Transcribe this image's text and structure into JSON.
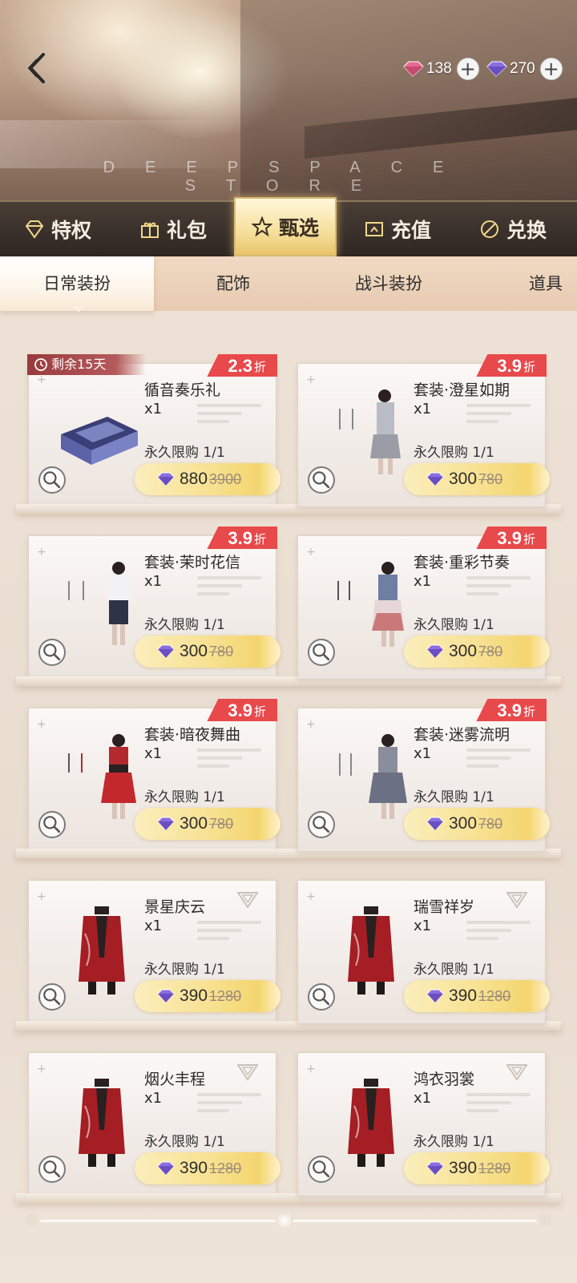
{
  "header": {
    "store_title": "DEEPSPACE STORE",
    "back_icon": "back-chevron-icon",
    "currencies": [
      {
        "icon": "pink-gem-icon",
        "amount": "138",
        "color": "#e66a8f"
      },
      {
        "icon": "purple-gem-icon",
        "amount": "270",
        "color": "#8b6ee0"
      }
    ]
  },
  "main_tabs": [
    {
      "label": "特权",
      "icon": "diamond-icon",
      "active": false
    },
    {
      "label": "礼包",
      "icon": "gift-icon",
      "active": false
    },
    {
      "label": "甄选",
      "icon": "star-icon",
      "active": true
    },
    {
      "label": "充值",
      "icon": "recharge-icon",
      "active": false
    },
    {
      "label": "兑换",
      "icon": "exchange-icon",
      "active": false
    }
  ],
  "sub_tabs": [
    {
      "label": "日常装扮",
      "active": true
    },
    {
      "label": "配饰",
      "active": false
    },
    {
      "label": "战斗装扮",
      "active": false
    },
    {
      "label": "道具",
      "active": false
    }
  ],
  "items": [
    {
      "name": "循音奏乐礼",
      "qty": "x1",
      "limit": "永久限购 1/1",
      "price": "880",
      "original_price": "3900",
      "discount": "2.3",
      "discount_unit": "折",
      "remain": "剩余15天",
      "thumb": "gift-box"
    },
    {
      "name": "套装·澄星如期",
      "qty": "x1",
      "limit": "永久限购 1/1",
      "price": "300",
      "original_price": "780",
      "discount": "3.9",
      "discount_unit": "折",
      "remain": "",
      "thumb": "outfit-grey"
    },
    {
      "name": "套装·茉时花信",
      "qty": "x1",
      "limit": "永久限购 1/1",
      "price": "300",
      "original_price": "780",
      "discount": "3.9",
      "discount_unit": "折",
      "remain": "",
      "thumb": "outfit-white"
    },
    {
      "name": "套装·重彩节奏",
      "qty": "x1",
      "limit": "永久限购 1/1",
      "price": "300",
      "original_price": "780",
      "discount": "3.9",
      "discount_unit": "折",
      "remain": "",
      "thumb": "outfit-denim"
    },
    {
      "name": "套装·暗夜舞曲",
      "qty": "x1",
      "limit": "永久限购 1/1",
      "price": "300",
      "original_price": "780",
      "discount": "3.9",
      "discount_unit": "折",
      "remain": "",
      "thumb": "outfit-red"
    },
    {
      "name": "套装·迷雾流明",
      "qty": "x1",
      "limit": "永久限购 1/1",
      "price": "300",
      "original_price": "780",
      "discount": "3.9",
      "discount_unit": "折",
      "remain": "",
      "thumb": "outfit-silver"
    },
    {
      "name": "景星庆云",
      "qty": "x1",
      "limit": "永久限购 1/1",
      "price": "390",
      "original_price": "1280",
      "discount": "",
      "discount_unit": "",
      "remain": "",
      "thumb": "coat-red"
    },
    {
      "name": "瑞雪祥岁",
      "qty": "x1",
      "limit": "永久限购 1/1",
      "price": "390",
      "original_price": "1280",
      "discount": "",
      "discount_unit": "",
      "remain": "",
      "thumb": "coat-red"
    },
    {
      "name": "烟火丰程",
      "qty": "x1",
      "limit": "永久限购 1/1",
      "price": "390",
      "original_price": "1280",
      "discount": "",
      "discount_unit": "",
      "remain": "",
      "thumb": "coat-red"
    },
    {
      "name": "鸿衣羽裳",
      "qty": "x1",
      "limit": "永久限购 1/1",
      "price": "390",
      "original_price": "1280",
      "discount": "",
      "discount_unit": "",
      "remain": "",
      "thumb": "coat-red"
    }
  ],
  "colors": {
    "discount_badge": "#e8494b",
    "price_button": "#f7e08e",
    "remain_badge": "#9a3a3c",
    "active_tab": "#f6df9c"
  }
}
